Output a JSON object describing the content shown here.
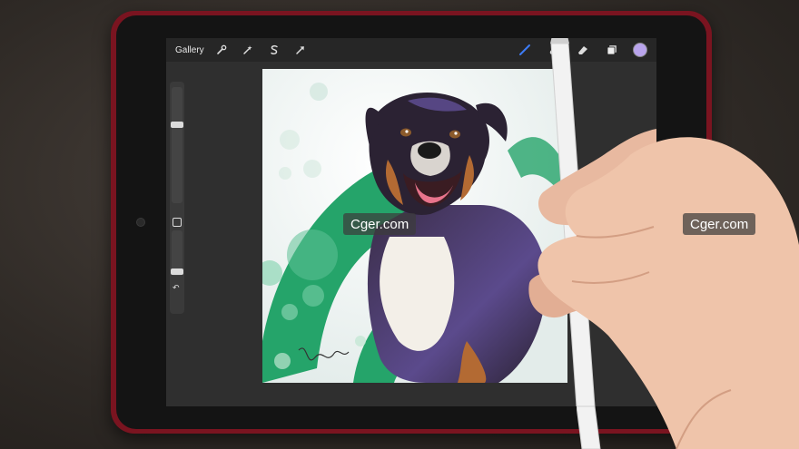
{
  "app": {
    "gallery_label": "Gallery",
    "toolbar_left_icons": [
      "wrench-icon",
      "magic-wand-icon",
      "selection-s-icon",
      "transform-arrow-icon"
    ],
    "toolbar_right_icons": [
      "brush-icon",
      "smudge-icon",
      "eraser-icon",
      "layers-icon"
    ],
    "active_tool": "brush",
    "current_color": "#b9a4ec"
  },
  "sidebar": {
    "top_slider_label": "brush-size",
    "bottom_slider_label": "opacity",
    "undo_glyph": "↶"
  },
  "canvas": {
    "subject": "dog-painting",
    "accent_colors": {
      "green": "#25a46a",
      "dog_dark": "#2b2233",
      "dog_purple": "#5b4a8c",
      "tongue": "#e8748c",
      "fur_tan": "#b36a33",
      "fur_white": "#f3efe8"
    }
  },
  "watermarks": {
    "left": "Cger.com",
    "right": "Cger.com"
  }
}
